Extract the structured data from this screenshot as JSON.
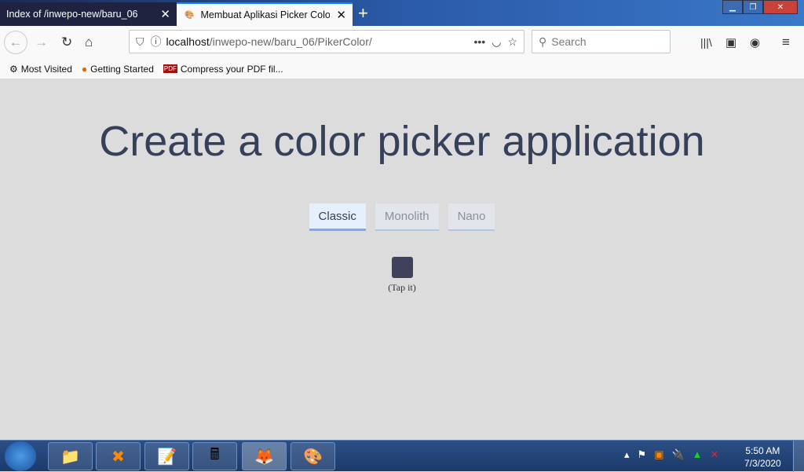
{
  "browser": {
    "tabs": [
      {
        "title": "Index of /inwepo-new/baru_06",
        "close": "✕"
      },
      {
        "title": "Membuat Aplikasi Picker Color",
        "close": "✕"
      }
    ],
    "new_tab": "+",
    "url_host": "localhost",
    "url_path": "/inwepo-new/baru_06/PikerColor/",
    "search_placeholder": "Search",
    "bookmarks": [
      "Most Visited",
      "Getting Started",
      "Compress your PDF fil..."
    ]
  },
  "page": {
    "title": "Create a color picker application",
    "themes": [
      "Classic",
      "Monolith",
      "Nano"
    ],
    "swatch_color": "#40415a",
    "hint": "(Tap it)"
  },
  "taskbar": {
    "time": "5:50 AM",
    "date": "7/3/2020"
  }
}
